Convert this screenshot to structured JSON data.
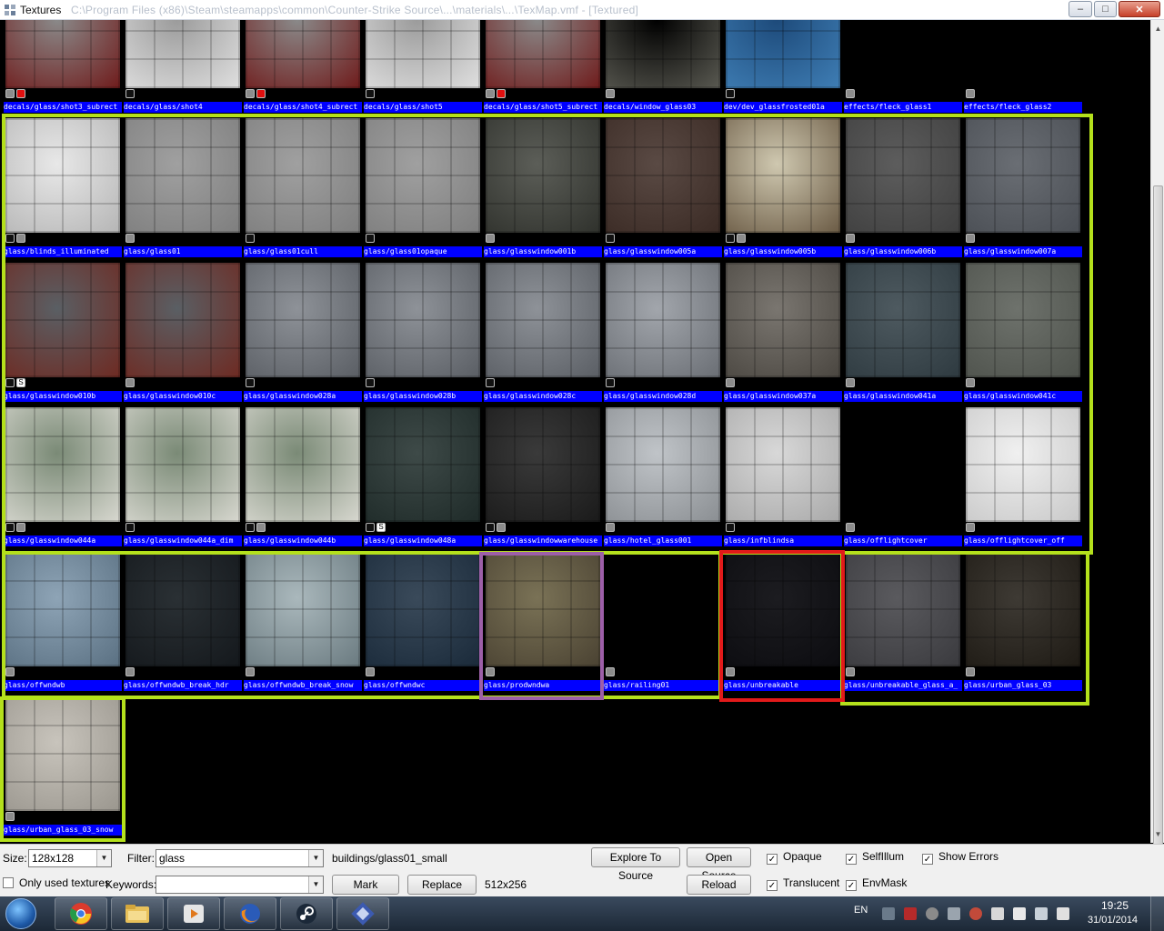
{
  "window": {
    "title": "Textures",
    "path": "C:\\Program Files (x86)\\Steam\\steamapps\\common\\Counter-Strike Source\\...\\materials\\...\\TexMap.vmf - [Textured]",
    "minimize_label": "‒",
    "maximize_label": "□",
    "close_label": "✕"
  },
  "colors": {
    "highlight_green": "#b4e01c",
    "selection_red": "#e21a1a",
    "selection_purple": "#9d5fa8",
    "label_blue": "#0000ff"
  },
  "textures": [
    {
      "name": "decals/glass/shot3_subrect",
      "colors": [
        "#8a8a8a",
        "#6f1b1b"
      ],
      "badges": [
        "gray",
        "red"
      ]
    },
    {
      "name": "decals/glass/shot4",
      "colors": [
        "#9b9b9b",
        "#e0e0e0"
      ],
      "badges": [
        "black"
      ]
    },
    {
      "name": "decals/glass/shot4_subrect",
      "colors": [
        "#8a8a8a",
        "#6f1b1b"
      ],
      "badges": [
        "gray",
        "red"
      ]
    },
    {
      "name": "decals/glass/shot5",
      "colors": [
        "#9b9b9b",
        "#e0e0e0"
      ],
      "badges": [
        "black"
      ]
    },
    {
      "name": "decals/glass/shot5_subrect",
      "colors": [
        "#8a8a8a",
        "#6f1b1b"
      ],
      "badges": [
        "gray",
        "red"
      ]
    },
    {
      "name": "decals/window_glass03",
      "colors": [
        "#000000",
        "#5a5a52"
      ],
      "badges": [
        "gray"
      ]
    },
    {
      "name": "dev/dev_glassfrosted01a",
      "colors": [
        "#1d4a7a",
        "#3f7eb5"
      ],
      "badges": [
        "black"
      ]
    },
    {
      "name": "effects/fleck_glass1",
      "colors": [
        "#000000",
        "#000000"
      ],
      "badges": [
        "gray"
      ]
    },
    {
      "name": "effects/fleck_glass2",
      "colors": [
        "#000000",
        "#000000"
      ],
      "badges": [
        "gray"
      ]
    },
    {
      "name": "glass/blinds_illuminated",
      "colors": [
        "#e8e8e8",
        "#b5b5b5"
      ],
      "badges": [
        "black",
        "gray"
      ]
    },
    {
      "name": "glass/glass01",
      "colors": [
        "#a0a0a0",
        "#7e7e7e"
      ],
      "badges": [
        "gray"
      ]
    },
    {
      "name": "glass/glass01cull",
      "colors": [
        "#a0a0a0",
        "#7e7e7e"
      ],
      "badges": [
        "black"
      ]
    },
    {
      "name": "glass/glass01opaque",
      "colors": [
        "#a0a0a0",
        "#7e7e7e"
      ],
      "badges": [
        "black"
      ]
    },
    {
      "name": "glass/glasswindow001b",
      "colors": [
        "#5c5e58",
        "#2f312c"
      ],
      "badges": [
        "gray"
      ]
    },
    {
      "name": "glass/glasswindow005a",
      "colors": [
        "#5a4a44",
        "#3a2a24"
      ],
      "badges": [
        "black"
      ]
    },
    {
      "name": "glass/glasswindow005b",
      "colors": [
        "#cfc8b0",
        "#6a5a44"
      ],
      "badges": [
        "black",
        "gray"
      ]
    },
    {
      "name": "glass/glasswindow006b",
      "colors": [
        "#5d5d5d",
        "#3f3f3f"
      ],
      "badges": [
        "gray"
      ]
    },
    {
      "name": "glass/glasswindow007a",
      "colors": [
        "#6a6e74",
        "#4a4e54"
      ],
      "badges": [
        "gray"
      ]
    },
    {
      "name": "glass/glasswindow010b",
      "colors": [
        "#5a5f64",
        "#6e2a22"
      ],
      "badges": [
        "black",
        "s"
      ]
    },
    {
      "name": "glass/glasswindow010c",
      "colors": [
        "#5a5f64",
        "#6e2a22"
      ],
      "badges": [
        "gray"
      ]
    },
    {
      "name": "glass/glasswindow028a",
      "colors": [
        "#8e9298",
        "#5a5e64"
      ],
      "badges": [
        "black"
      ]
    },
    {
      "name": "glass/glasswindow028b",
      "colors": [
        "#8e9298",
        "#5a5e64"
      ],
      "badges": [
        "black"
      ]
    },
    {
      "name": "glass/glasswindow028c",
      "colors": [
        "#8e9298",
        "#5a5e64"
      ],
      "badges": [
        "black"
      ]
    },
    {
      "name": "glass/glasswindow028d",
      "colors": [
        "#a2a6ac",
        "#6a6e74"
      ],
      "badges": [
        "black"
      ]
    },
    {
      "name": "glass/glasswindow037a",
      "colors": [
        "#7a7670",
        "#4a4640"
      ],
      "badges": [
        "gray"
      ]
    },
    {
      "name": "glass/glasswindow041a",
      "colors": [
        "#4e5a60",
        "#2e3a40"
      ],
      "badges": [
        "gray"
      ]
    },
    {
      "name": "glass/glasswindow041c",
      "colors": [
        "#6e726c",
        "#4e524c"
      ],
      "badges": [
        "gray"
      ]
    },
    {
      "name": "glass/glasswindow044a",
      "colors": [
        "#7a8a76",
        "#d8d8d0"
      ],
      "badges": [
        "black",
        "gray"
      ]
    },
    {
      "name": "glass/glasswindow044a_dim",
      "colors": [
        "#7a8a76",
        "#d8d8d0"
      ],
      "badges": [
        "black"
      ]
    },
    {
      "name": "glass/glasswindow044b",
      "colors": [
        "#7a8a76",
        "#d8d8d0"
      ],
      "badges": [
        "black",
        "gray"
      ]
    },
    {
      "name": "glass/glasswindow048a",
      "colors": [
        "#3e4a48",
        "#1e2a28"
      ],
      "badges": [
        "black",
        "s"
      ]
    },
    {
      "name": "glass/glasswindowwarehouse",
      "colors": [
        "#3a3a3a",
        "#1a1a1a"
      ],
      "badges": [
        "black",
        "gray"
      ]
    },
    {
      "name": "glass/hotel_glass001",
      "colors": [
        "#c0c4c8",
        "#8a8e92"
      ],
      "badges": [
        "gray"
      ]
    },
    {
      "name": "glass/infblindsa",
      "colors": [
        "#d8d8d8",
        "#a8a8a8"
      ],
      "badges": [
        "black"
      ]
    },
    {
      "name": "glass/offlightcover",
      "colors": [
        "#000000",
        "#000000"
      ],
      "badges": [
        "gray"
      ]
    },
    {
      "name": "glass/offlightcover_off",
      "colors": [
        "#f0f0f0",
        "#c8c8c8"
      ],
      "badges": [
        "gray"
      ]
    },
    {
      "name": "glass/offwndwb",
      "colors": [
        "#8ea4b6",
        "#5a7082"
      ],
      "badges": [
        "gray"
      ]
    },
    {
      "name": "glass/offwndwb_break_hdr",
      "colors": [
        "#2a3034",
        "#14181c"
      ],
      "badges": [
        "gray"
      ]
    },
    {
      "name": "glass/offwndwb_break_snow",
      "colors": [
        "#aab8bc",
        "#6a7a80"
      ],
      "badges": [
        "gray"
      ]
    },
    {
      "name": "glass/offwndwc",
      "colors": [
        "#3a4a5a",
        "#1a2a3a"
      ],
      "badges": [
        "gray"
      ]
    },
    {
      "name": "glass/prodwndwa",
      "colors": [
        "#7a7256",
        "#4a4232"
      ],
      "badges": [
        "gray"
      ]
    },
    {
      "name": "glass/railing01",
      "colors": [
        "#000000",
        "#000000"
      ],
      "badges": [
        "gray"
      ]
    },
    {
      "name": "glass/unbreakable",
      "colors": [
        "#1c1c20",
        "#0c0c10"
      ],
      "badges": [
        "gray"
      ]
    },
    {
      "name": "glass/unbreakable_glass_a_",
      "colors": [
        "#5a5a5e",
        "#3a3a3e"
      ],
      "badges": [
        "gray"
      ]
    },
    {
      "name": "glass/urban_glass_03",
      "colors": [
        "#3e3a34",
        "#1e1a14"
      ],
      "badges": [
        "gray"
      ]
    },
    {
      "name": "glass/urban_glass_03_snow",
      "colors": [
        "#c8c4bc",
        "#9a968e"
      ],
      "badges": [
        "gray"
      ]
    }
  ],
  "toolbar": {
    "size_label": "Size:",
    "size_value": "128x128",
    "filter_label": "Filter:",
    "filter_value": "glass",
    "current_texture": "buildings/glass01_small",
    "explore_button": "Explore To Source",
    "open_source_button": "Open Source",
    "opaque_label": "Opaque",
    "selfillum_label": "SelfIllum",
    "show_errors_label": "Show Errors",
    "only_used_label": "Only used textures",
    "keywords_label": "Keywords:",
    "keywords_value": "",
    "mark_button": "Mark",
    "replace_button": "Replace",
    "texture_dims": "512x256",
    "reload_button": "Reload",
    "translucent_label": "Translucent",
    "envmask_label": "EnvMask",
    "checks": {
      "opaque": true,
      "selfillum": true,
      "show_errors": true,
      "only_used": false,
      "translucent": true,
      "envmask": true
    },
    "check_mark": "✓"
  },
  "taskbar": {
    "language": "EN",
    "time": "19:25",
    "date": "31/01/2014",
    "apps": [
      "chrome-icon",
      "file-explorer-icon",
      "media-player-icon",
      "firefox-icon",
      "steam-icon",
      "hammer-editor-icon"
    ]
  }
}
